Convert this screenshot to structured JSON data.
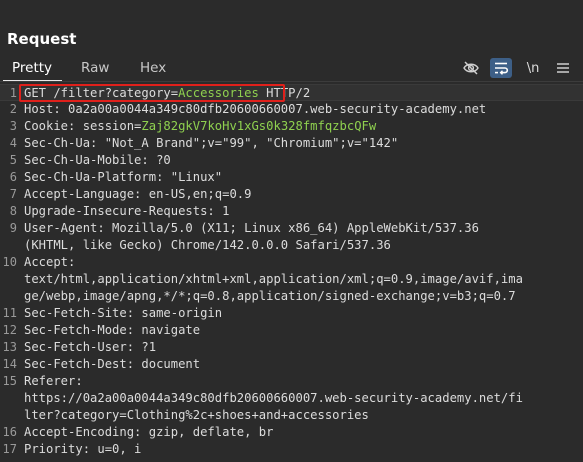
{
  "panel": {
    "title": "Request"
  },
  "tabs": [
    {
      "label": "Pretty"
    },
    {
      "label": "Raw"
    },
    {
      "label": "Hex"
    }
  ],
  "toolbar": {
    "icons": [
      "eye-off-icon",
      "wrap-text-icon",
      "newline-toggle",
      "menu-icon"
    ],
    "newline_label": "\\n"
  },
  "request_lines": [
    {
      "n": "1",
      "text": "GET /filter?category=",
      "value": "Accessories",
      "tail": " HTTP/2"
    },
    {
      "n": "2",
      "text": "Host: 0a2a00a0044a349c80dfb20600660007.web-security-academy.net"
    },
    {
      "n": "3",
      "text": "Cookie: session=",
      "value": "Zaj82gkV7koHv1xGs0k328fmfqzbcQFw"
    },
    {
      "n": "4",
      "text": "Sec-Ch-Ua: \"Not_A Brand\";v=\"99\", \"Chromium\";v=\"142\""
    },
    {
      "n": "5",
      "text": "Sec-Ch-Ua-Mobile: ?0"
    },
    {
      "n": "6",
      "text": "Sec-Ch-Ua-Platform: \"Linux\""
    },
    {
      "n": "7",
      "text": "Accept-Language: en-US,en;q=0.9"
    },
    {
      "n": "8",
      "text": "Upgrade-Insecure-Requests: 1"
    },
    {
      "n": "9",
      "text": "User-Agent: Mozilla/5.0 (X11; Linux x86_64) AppleWebKit/537.36"
    },
    {
      "n": "",
      "text": "(KHTML, like Gecko) Chrome/142.0.0.0 Safari/537.36"
    },
    {
      "n": "10",
      "text": "Accept:"
    },
    {
      "n": "",
      "text": "text/html,application/xhtml+xml,application/xml;q=0.9,image/avif,ima"
    },
    {
      "n": "",
      "text": "ge/webp,image/apng,*/*;q=0.8,application/signed-exchange;v=b3;q=0.7"
    },
    {
      "n": "11",
      "text": "Sec-Fetch-Site: same-origin"
    },
    {
      "n": "12",
      "text": "Sec-Fetch-Mode: navigate"
    },
    {
      "n": "13",
      "text": "Sec-Fetch-User: ?1"
    },
    {
      "n": "14",
      "text": "Sec-Fetch-Dest: document"
    },
    {
      "n": "15",
      "text": "Referer:"
    },
    {
      "n": "",
      "text": "https://0a2a00a0044a349c80dfb20600660007.web-security-academy.net/fi"
    },
    {
      "n": "",
      "text": "lter?category=Clothing%2c+shoes+and+accessories"
    },
    {
      "n": "16",
      "text": "Accept-Encoding: gzip, deflate, br"
    },
    {
      "n": "17",
      "text": "Priority: u=0, i"
    }
  ],
  "colors": {
    "background": "#2b2b2b",
    "param_value": "#8fd14f",
    "highlight_border": "#e0201b",
    "selected_tool": "#3d5f87"
  }
}
